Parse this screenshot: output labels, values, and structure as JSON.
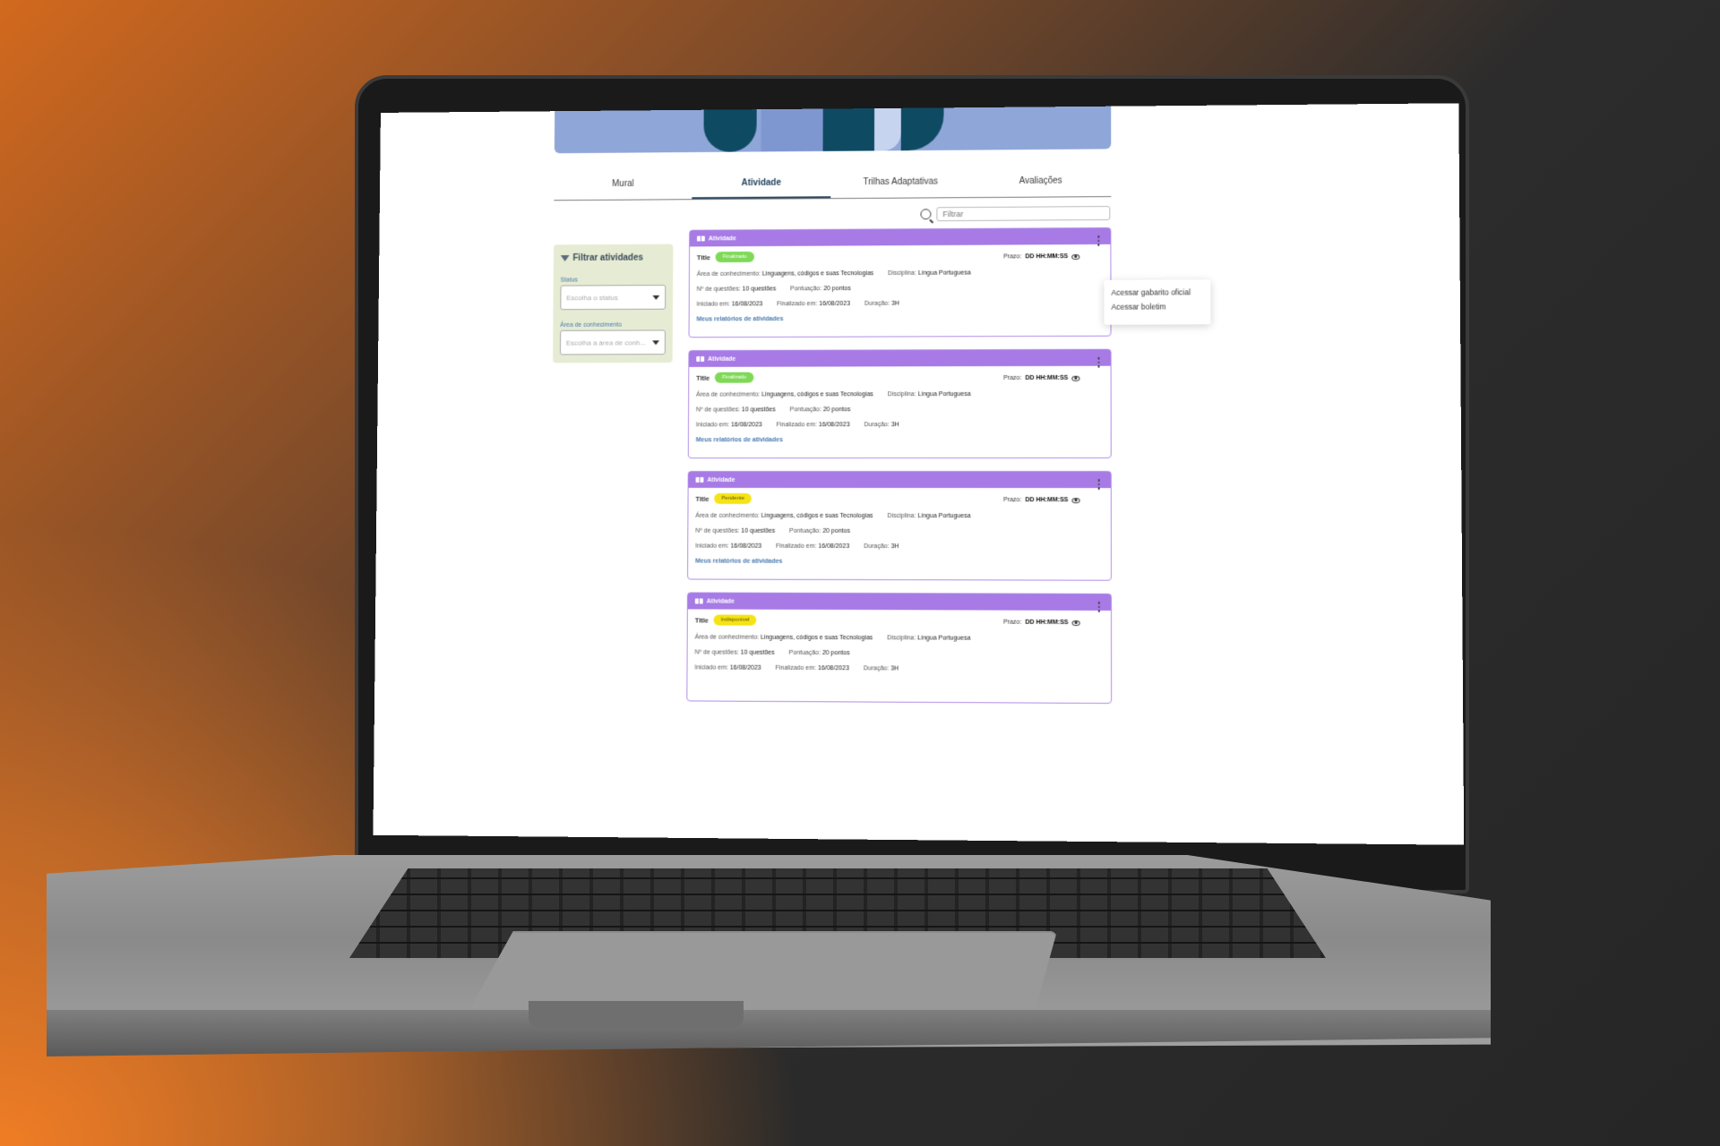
{
  "tabs": [
    "Mural",
    "Atividade",
    "Trilhas Adaptativas",
    "Avaliações"
  ],
  "search": {
    "placeholder": "Filtrar"
  },
  "filter": {
    "title": "Filtrar atividades",
    "status_label": "Status",
    "status_placeholder": "Escolha o status",
    "area_label": "Área de conhecimento",
    "area_placeholder": "Escolha a área de conh..."
  },
  "dropdown": {
    "items": [
      "Acessar gabarito oficial",
      "Acessar boletim"
    ]
  },
  "cards": [
    {
      "header": "Atividade",
      "title": "Title",
      "status": "Finalizado",
      "prazo_label": "Prazo:",
      "prazo_value": "DD HH:MM:SS",
      "area_label": "Área de conhecimento:",
      "area_value": "Linguagens, códigos e suas Tecnologias",
      "disciplina_label": "Disciplina:",
      "disciplina_value": "Língua Portuguesa",
      "questoes_label": "Nº de questões:",
      "questoes_value": "10 questões",
      "pontuacao_label": "Pontuação:",
      "pontuacao_value": "20 pontos",
      "iniciado_label": "Iniciado em:",
      "iniciado_value": "16/08/2023",
      "finalizado_label": "Finalizado em:",
      "finalizado_value": "16/08/2023",
      "duracao_label": "Duração:",
      "duracao_value": "3H",
      "link": "Meus relatórios de atividades"
    },
    {
      "header": "Atividade",
      "title": "Title",
      "status": "Finalizado",
      "prazo_label": "Prazo:",
      "prazo_value": "DD HH:MM:SS",
      "area_label": "Área de conhecimento:",
      "area_value": "Linguagens, códigos e suas Tecnologias",
      "disciplina_label": "Disciplina:",
      "disciplina_value": "Língua Portuguesa",
      "questoes_label": "Nº de questões:",
      "questoes_value": "10 questões",
      "pontuacao_label": "Pontuação:",
      "pontuacao_value": "20 pontos",
      "iniciado_label": "Iniciado em:",
      "iniciado_value": "16/08/2023",
      "finalizado_label": "Finalizado em:",
      "finalizado_value": "16/08/2023",
      "duracao_label": "Duração:",
      "duracao_value": "3H",
      "link": "Meus relatórios de atividades"
    },
    {
      "header": "Atividade",
      "title": "Title",
      "status": "Pendente",
      "prazo_label": "Prazo:",
      "prazo_value": "DD HH:MM:SS",
      "area_label": "Área de conhecimento:",
      "area_value": "Linguagens, códigos e suas Tecnologias",
      "disciplina_label": "Disciplina:",
      "disciplina_value": "Língua Portuguesa",
      "questoes_label": "Nº de questões:",
      "questoes_value": "10 questões",
      "pontuacao_label": "Pontuação:",
      "pontuacao_value": "20 pontos",
      "iniciado_label": "Iniciado em:",
      "iniciado_value": "16/08/2023",
      "finalizado_label": "Finalizado em:",
      "finalizado_value": "16/08/2023",
      "duracao_label": "Duração:",
      "duracao_value": "3H",
      "link": "Meus relatórios de atividades"
    },
    {
      "header": "Atividade",
      "title": "Title",
      "status": "Indisponível",
      "prazo_label": "Prazo:",
      "prazo_value": "DD HH:MM:SS",
      "area_label": "Área de conhecimento:",
      "area_value": "Linguagens, códigos e suas Tecnologias",
      "disciplina_label": "Disciplina:",
      "disciplina_value": "Língua Portuguesa",
      "questoes_label": "Nº de questões:",
      "questoes_value": "10 questões",
      "pontuacao_label": "Pontuação:",
      "pontuacao_value": "20 pontos",
      "iniciado_label": "Iniciado em:",
      "iniciado_value": "16/08/2023",
      "finalizado_label": "Finalizado em:",
      "finalizado_value": "16/08/2023",
      "duracao_label": "Duração:",
      "duracao_value": "3H",
      "link": ""
    }
  ],
  "colors": {
    "card_header": "#a77ae6",
    "badge_finalizado": "#7ed957",
    "badge_pendente": "#f5e316",
    "filter_panel": "#e6ecd3",
    "banner": "#8fa6d8"
  }
}
